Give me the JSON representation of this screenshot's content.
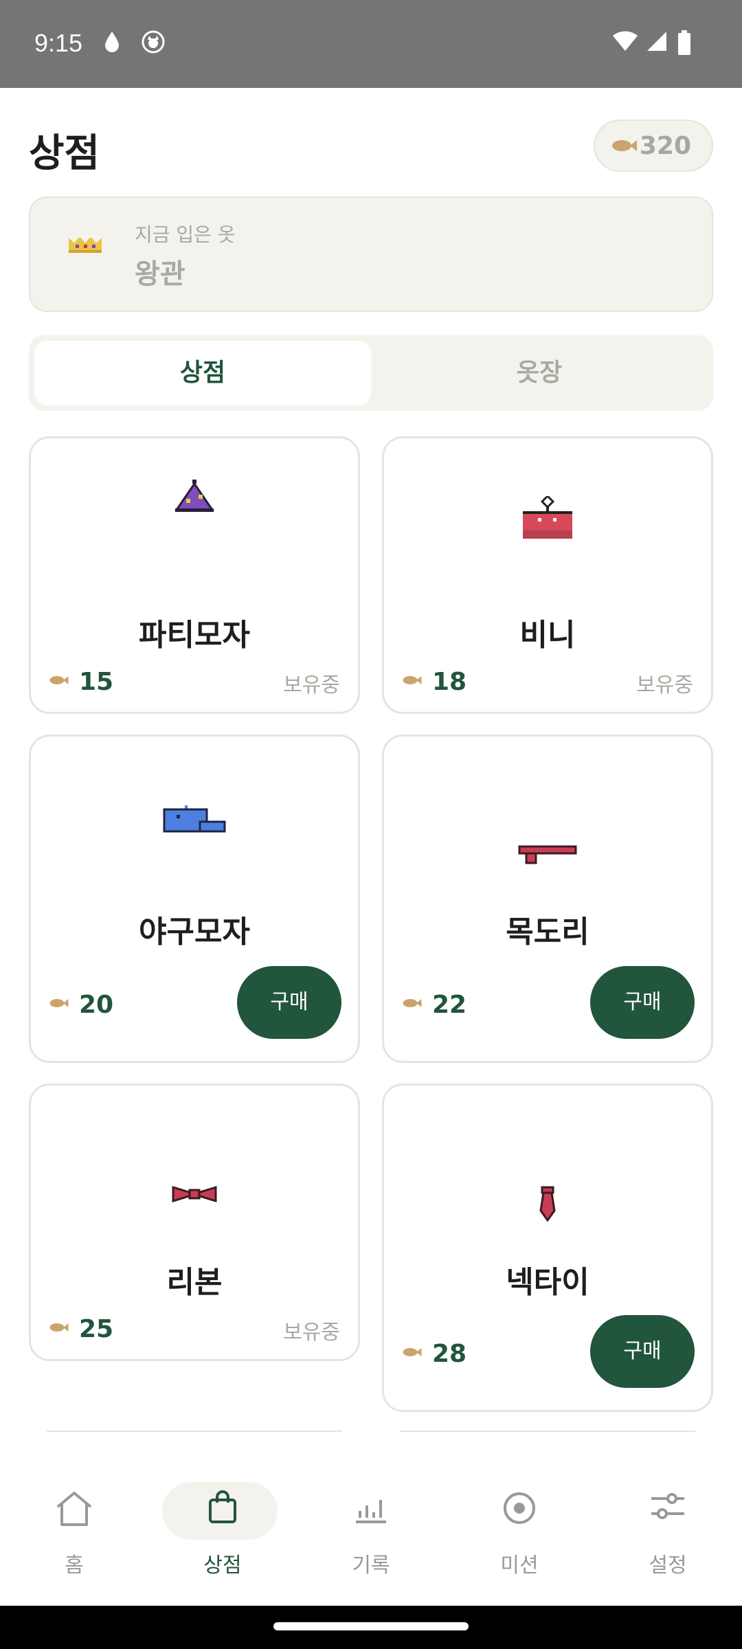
{
  "status": {
    "time": "9:15"
  },
  "header": {
    "title": "상점",
    "coins": "320"
  },
  "wearing": {
    "label": "지금 입은 옷",
    "item": "왕관"
  },
  "tabs": [
    {
      "label": "상점"
    },
    {
      "label": "옷장"
    }
  ],
  "items": [
    {
      "name": "파티모자",
      "price": "15",
      "status": "보유중",
      "icon": "party-hat"
    },
    {
      "name": "비니",
      "price": "18",
      "status": "보유중",
      "icon": "beanie"
    },
    {
      "name": "야구모자",
      "price": "20",
      "button": "구매",
      "icon": "baseball-cap"
    },
    {
      "name": "목도리",
      "price": "22",
      "button": "구매",
      "icon": "scarf"
    },
    {
      "name": "리본",
      "price": "25",
      "status": "보유중",
      "icon": "ribbon"
    },
    {
      "name": "넥타이",
      "price": "28",
      "button": "구매",
      "icon": "necktie"
    }
  ],
  "nav": [
    {
      "label": "홈",
      "icon": "home-icon"
    },
    {
      "label": "상점",
      "icon": "shopping-bag-icon",
      "active": true
    },
    {
      "label": "기록",
      "icon": "chart-icon"
    },
    {
      "label": "미션",
      "icon": "target-icon"
    },
    {
      "label": "설정",
      "icon": "sliders-icon"
    }
  ],
  "colors": {
    "accent": "#21553c",
    "surface": "#f3f2ec",
    "muted": "#a9a9a2"
  }
}
